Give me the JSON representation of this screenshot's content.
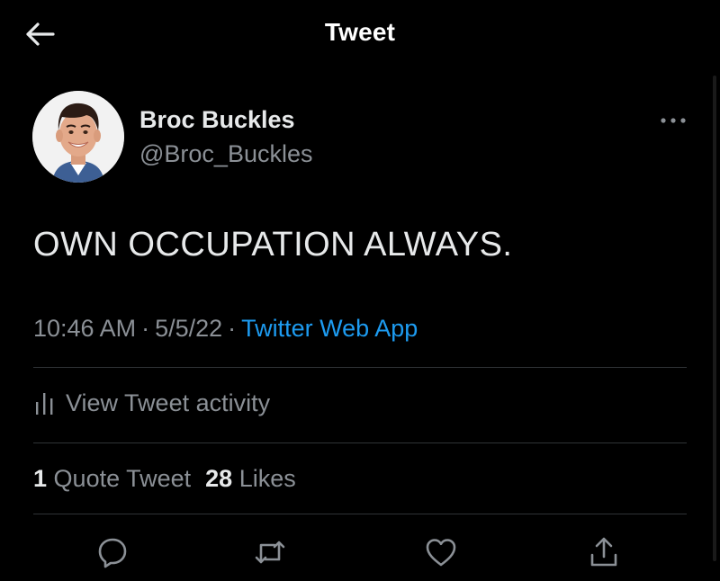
{
  "header": {
    "title": "Tweet",
    "back_icon": "arrow-left-icon"
  },
  "tweet": {
    "author_name": "Broc Buckles",
    "author_handle": "@Broc_Buckles",
    "text": "OWN OCCUPATION ALWAYS.",
    "time": "10:46 AM",
    "separator": "·",
    "date": "5/5/22",
    "source": "Twitter Web App",
    "more_icon": "more-horizontal-icon"
  },
  "activity": {
    "label": "View Tweet activity",
    "icon": "bar-chart-icon"
  },
  "stats": {
    "quote_count": "1",
    "quote_label": "Quote Tweet",
    "likes_count": "28",
    "likes_label": "Likes"
  },
  "actions": [
    "reply-icon",
    "retweet-icon",
    "like-icon",
    "share-icon"
  ],
  "colors": {
    "background": "#000000",
    "text_primary": "#e7e9ea",
    "text_secondary": "#8b9096",
    "accent": "#1d9bf0",
    "divider": "#2f3336"
  }
}
